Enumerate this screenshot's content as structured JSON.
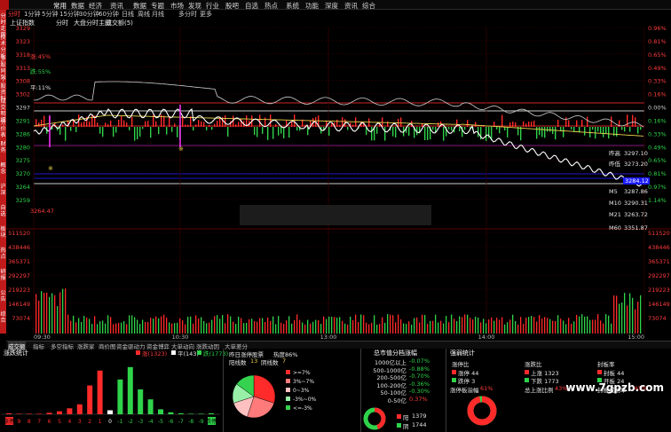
{
  "menu": {
    "items": [
      "常用",
      "数据",
      "经济",
      "资讯",
      "数据",
      "专题",
      "市场",
      "发现",
      "行业",
      "股吧",
      "自选",
      "热点",
      "系统",
      "功能",
      "深度",
      "资讯",
      "综合"
    ],
    "active": 0
  },
  "sidebar": {
    "labels": [
      "分时走势",
      "技术分析",
      "多股同列",
      "个股资料",
      "成交明细",
      "分价表",
      "财务",
      "概念",
      "沪深",
      "自选",
      "板块",
      "热点",
      "研报",
      "公告",
      "综合"
    ]
  },
  "periods": {
    "items": [
      "分时",
      "1分钟",
      "5分钟",
      "15分钟",
      "30分钟",
      "60分钟",
      "日线",
      "周线",
      "月线",
      "多分时",
      "更多"
    ],
    "selected": 0
  },
  "info": {
    "index_name": "上证指数",
    "mode": "分时",
    "title": "大盘分时主图",
    "volume_label": "成交额(5)"
  },
  "price_axis": {
    "left_ticks": [
      "3329",
      "3323",
      "3318",
      "3313",
      "3308",
      "3302",
      "3297",
      "3291",
      "3286",
      "3280",
      "3275",
      "3270",
      "3264",
      "3259"
    ],
    "right_ticks": [
      "0.96%",
      "0.81%",
      "0.65%",
      "0.49%",
      "0.33%",
      "0.16%",
      "0.00%",
      "0.16%",
      "0.33%",
      "0.49%",
      "0.65%",
      "0.81%",
      "0.97%",
      "1.14%"
    ]
  },
  "volume_axis": {
    "left_ticks": [
      "511520",
      "438446",
      "365371",
      "292297",
      "219223",
      "146149",
      "73074"
    ],
    "right_ticks": [
      "511520",
      "438446",
      "365371",
      "292297",
      "219223",
      "146149",
      "73074"
    ]
  },
  "time_labels": [
    "09:30",
    "10:30",
    "13:00",
    "14:00",
    "15:00"
  ],
  "overlays": {
    "ratio_up": "涨:45%",
    "ratio_down": "跌:55%",
    "ratio_flat": "平:11%",
    "low_price": "3264.47"
  },
  "ma_panel": [
    {
      "name": "昨高",
      "value": "3297.10"
    },
    {
      "name": "昨低",
      "value": "3273.20"
    },
    {
      "name": "M5",
      "value": "3287.86"
    },
    {
      "name": "M10",
      "value": "3290.31"
    },
    {
      "name": "M21",
      "value": "3263.72"
    },
    {
      "name": "M60",
      "value": "3351.87"
    },
    {
      "name": "current",
      "value": "3284.12"
    }
  ],
  "tabs": {
    "items": [
      "成交额",
      "指标",
      "多空指标",
      "涨跌家",
      "商价图",
      "资金驱动力",
      "资金博弈",
      "大单动向",
      "涨跌动因",
      "大单差分"
    ],
    "selected": 0
  },
  "panel_updown": {
    "title": "涨跌统计",
    "up_label": "涨(1323)",
    "flat_label": "平(143)",
    "down_label": "跌(1773)",
    "x_labels": [
      "涨停",
      "9",
      "8",
      "7",
      "6",
      "5",
      "4",
      "3",
      "2",
      "1",
      "0",
      "-1",
      "-2",
      "-3",
      "-4",
      "-5",
      "-6",
      "-7",
      "-8",
      "-9",
      "跌停"
    ]
  },
  "chart_data": {
    "type": "bar",
    "title": "",
    "categories": [
      "涨停",
      "9",
      "8",
      "7",
      "6",
      "5",
      "4",
      "3",
      "2",
      "1",
      "0",
      "-1",
      "-2",
      "-3",
      "-4",
      "-5",
      "-6",
      "-7",
      "-8",
      "-9",
      "跌停"
    ],
    "series": [
      {
        "values": [
          2,
          1,
          1,
          1,
          3,
          6,
          12,
          20,
          58,
          88,
          8,
          70,
          95,
          50,
          30,
          10,
          4,
          2,
          1,
          1,
          2
        ]
      }
    ],
    "ylim": [
      0,
      100
    ],
    "grid": false
  },
  "panel_heat": {
    "title_left": "昨日涨停股票",
    "title_right": "热度86%",
    "line2a": "阳线数",
    "line2b": "13",
    "line2c": "阴线数",
    "line2d": "7",
    "legend": [
      ">=7%",
      "3%~7%",
      "0~3%",
      "-3%~0%",
      "<=-3%"
    ],
    "legend_colors": [
      "#ff2a2a",
      "#ff7b7b",
      "#ffc0c0",
      "#98f0a8",
      "#35d24f"
    ],
    "pie": [
      30,
      25,
      15,
      15,
      15
    ]
  },
  "panel_cap": {
    "title": "总市值分档涨幅",
    "rows": [
      {
        "label": "1000亿以上",
        "value": "-0.07%"
      },
      {
        "label": "500-1000亿",
        "value": "-0.88%"
      },
      {
        "label": "200-500亿",
        "value": "-0.70%"
      },
      {
        "label": "100-200亿",
        "value": "-0.36%"
      },
      {
        "label": "50-100亿",
        "value": "-0.30%"
      },
      {
        "label": "0-50亿",
        "value": "0.37%"
      }
    ],
    "yang_label": "阳",
    "yang_value": "1379",
    "yin_label": "阴",
    "yin_value": "1744"
  },
  "panel_strength": {
    "title": "强弱统计",
    "zt_title": "涨停比",
    "zt_up": "涨停 44",
    "zt_down": "跌停 3",
    "zd_title": "涨跌比",
    "zd_up": "上涨 1323",
    "zd_down": "下跌 1773",
    "fb_title": "封板率",
    "fb_seal": "封板 44",
    "fb_open": "开板 24",
    "zt_rate_label": "涨停板溢幅",
    "zt_rate_value": "61%",
    "total_up_label": "总上涨比例",
    "total_up_value": "43%",
    "seal_rate_label": "封板成功率",
    "seal_rate_value": "65%"
  },
  "watermark": "www.7gpzb.com"
}
